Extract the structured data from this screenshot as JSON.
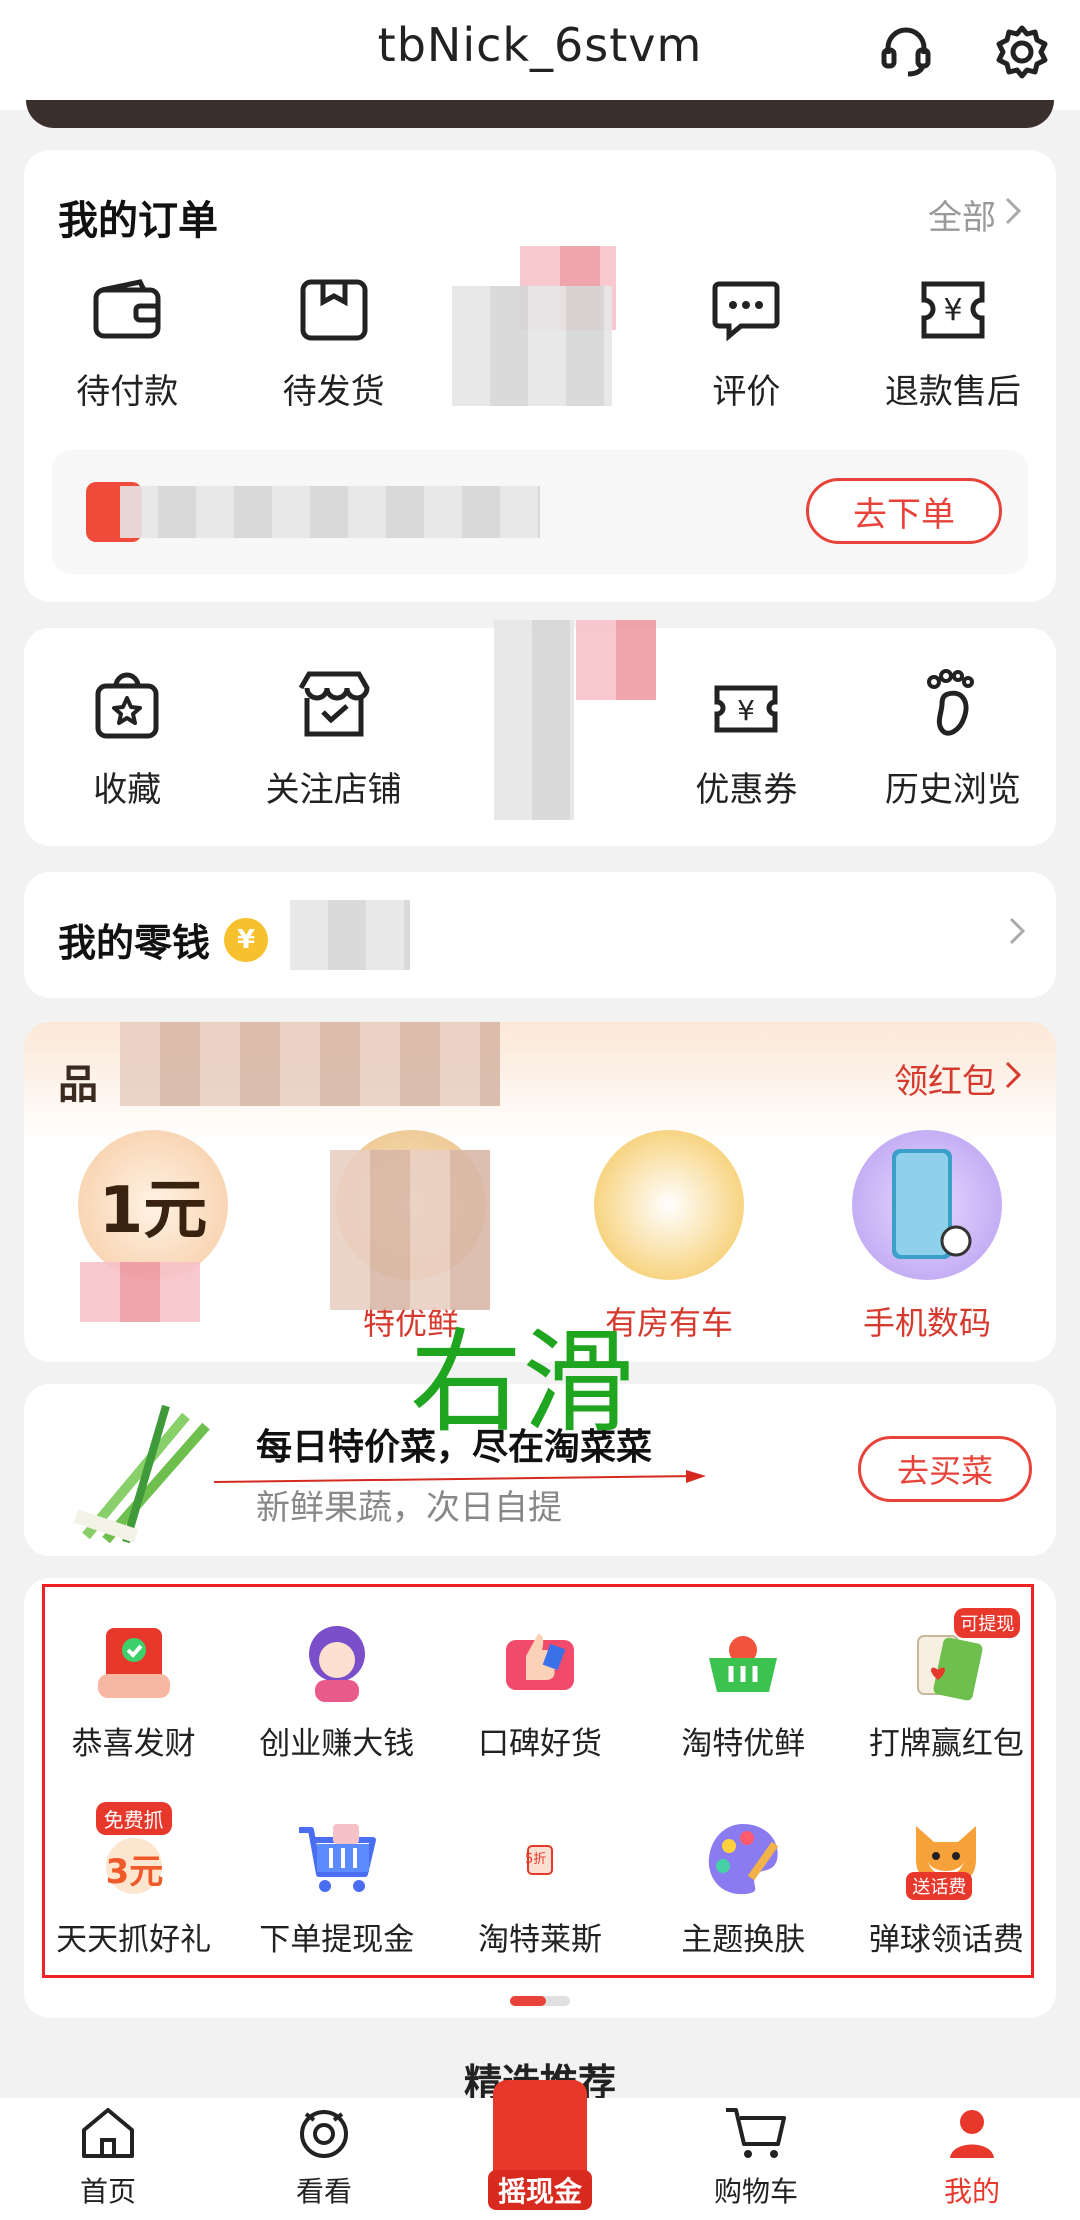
{
  "header": {
    "title": "tbNick_6stvm"
  },
  "orders": {
    "title": "我的订单",
    "all_label": "全部",
    "items": [
      {
        "label": "待付款",
        "icon": "wallet-icon"
      },
      {
        "label": "待发货",
        "icon": "package-icon"
      },
      {
        "label": "",
        "icon": "truck-icon"
      },
      {
        "label": "评价",
        "icon": "comment-icon"
      },
      {
        "label": "退款售后",
        "icon": "refund-icon"
      }
    ],
    "promo_button": "去下单"
  },
  "shortcuts": {
    "items": [
      {
        "label": "收藏",
        "icon": "star-bag-icon"
      },
      {
        "label": "关注店铺",
        "icon": "store-icon"
      },
      {
        "label": "",
        "icon": "hidden-icon"
      },
      {
        "label": "优惠券",
        "icon": "coupon-icon"
      },
      {
        "label": "历史浏览",
        "icon": "footprint-icon"
      }
    ]
  },
  "wallet": {
    "title": "我的零钱",
    "coin": "¥"
  },
  "brand": {
    "title": "品",
    "link": "领红包",
    "items": [
      {
        "label": "",
        "badge": "1元"
      },
      {
        "label": "特优鲜"
      },
      {
        "label": "有房有车"
      },
      {
        "label": "手机数码"
      }
    ]
  },
  "veg": {
    "main": "每日特价菜，尽在淘菜菜",
    "sub": "新鲜果蔬，次日自提",
    "button": "去买菜"
  },
  "overlay": {
    "text": "右滑"
  },
  "services": {
    "row1": [
      {
        "label": "恭喜发财",
        "icon": "red-envelope-icon"
      },
      {
        "label": "创业赚大钱",
        "icon": "avatar-girl-icon"
      },
      {
        "label": "口碑好货",
        "icon": "thumbs-up-icon"
      },
      {
        "label": "淘特优鲜",
        "icon": "basket-icon"
      },
      {
        "label": "打牌赢红包",
        "icon": "cards-icon",
        "tag": "可提现"
      }
    ],
    "row2": [
      {
        "label": "天天抓好礼",
        "icon": "claw-icon",
        "tag": "免费抓",
        "num": "3元"
      },
      {
        "label": "下单提现金",
        "icon": "cart-icon"
      },
      {
        "label": "淘特莱斯",
        "icon": "tag-icon",
        "num": "5折"
      },
      {
        "label": "主题换肤",
        "icon": "palette-icon"
      },
      {
        "label": "弹球领话费",
        "icon": "fox-icon",
        "tag": "送话费"
      }
    ]
  },
  "recommend": {
    "title": "精选推荐"
  },
  "tabbar": {
    "items": [
      {
        "label": "首页",
        "icon": "home-icon"
      },
      {
        "label": "看看",
        "icon": "eye-icon"
      },
      {
        "label": "摇现金",
        "icon": "red-bag-icon"
      },
      {
        "label": "购物车",
        "icon": "cart-icon"
      },
      {
        "label": "我的",
        "icon": "profile-icon"
      }
    ]
  },
  "colors": {
    "accent": "#e8433b",
    "overlay_green": "#1fa51f"
  }
}
